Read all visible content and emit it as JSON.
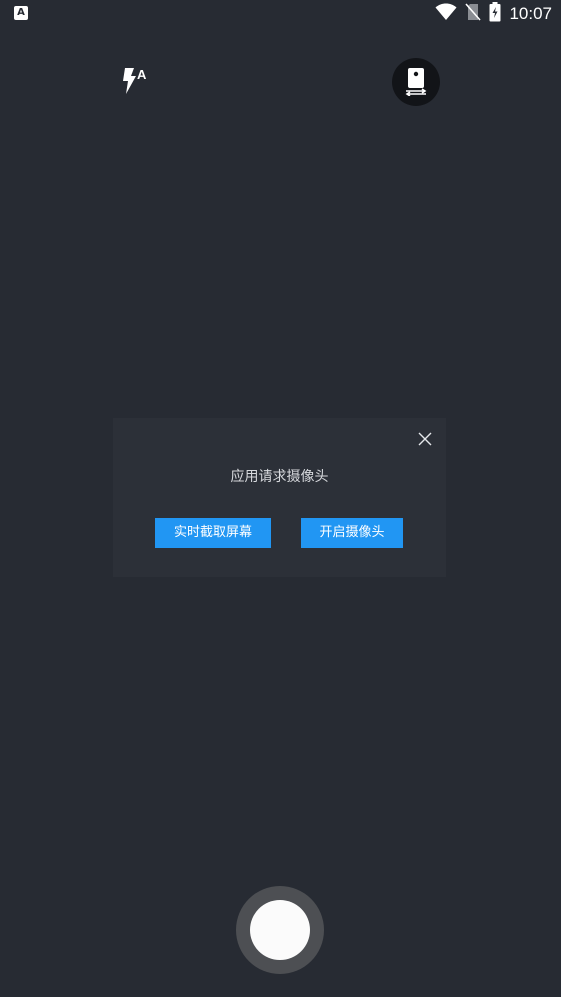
{
  "status_bar": {
    "app_icon_letter": "A",
    "time": "10:07",
    "icons": [
      "wifi-icon",
      "no-sim-icon",
      "battery-charging-icon"
    ]
  },
  "camera_controls": {
    "flash_mode_label": "A",
    "flash_icon": "flash-auto-icon",
    "switch_camera_icon": "switch-camera-icon"
  },
  "dialog": {
    "title": "应用请求摄像头",
    "close_icon": "close-icon",
    "buttons": {
      "screen_capture": "实时截取屏幕",
      "open_camera": "开启摄像头"
    },
    "button_color": "#2196f3"
  },
  "shutter": {
    "icon": "shutter-button"
  },
  "colors": {
    "background": "#272b33",
    "dialog_background": "#2c3038",
    "accent": "#2196f3"
  }
}
